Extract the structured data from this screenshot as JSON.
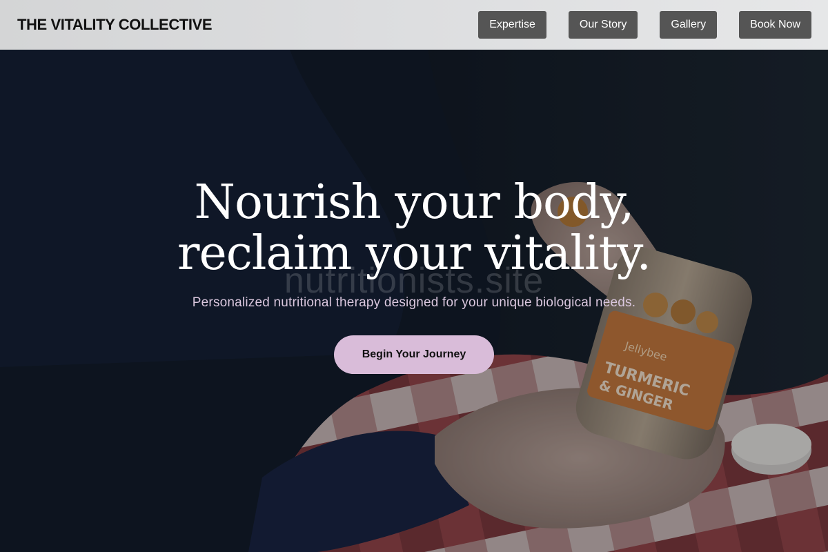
{
  "header": {
    "brand": "THE VITALITY COLLECTIVE",
    "nav": [
      {
        "label": "Expertise"
      },
      {
        "label": "Our Story"
      },
      {
        "label": "Gallery"
      },
      {
        "label": "Book Now"
      }
    ]
  },
  "hero": {
    "headline_line1": "Nourish your body,",
    "headline_line2": "reclaim your vitality.",
    "subtitle": "Personalized nutritional therapy designed for your unique biological needs.",
    "cta_label": "Begin Your Journey",
    "watermark": "nutritionists.site",
    "photo": {
      "jar_brand": "Jellybee",
      "jar_product": "TURMERIC & GINGER"
    }
  },
  "colors": {
    "header_bg": "#dcdddf",
    "nav_button_bg": "#555555",
    "cta_bg": "#d9bcd9",
    "subtitle_text": "#dac7de"
  }
}
